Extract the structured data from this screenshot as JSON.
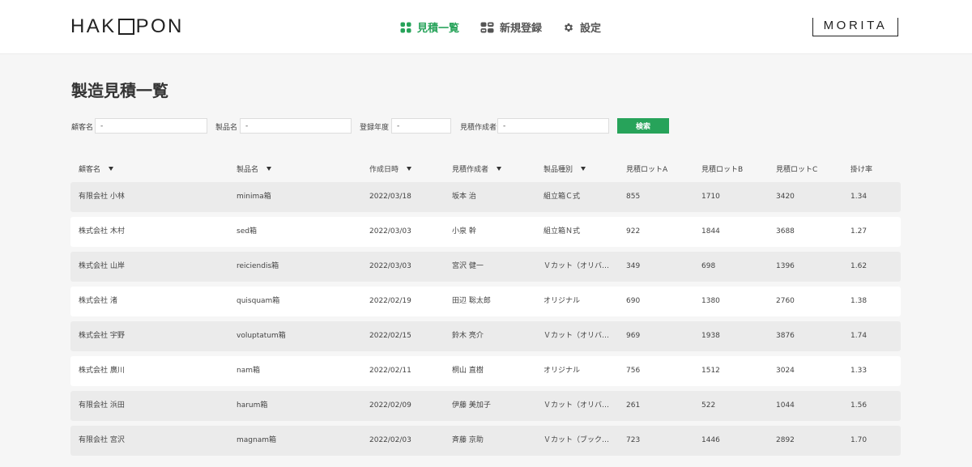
{
  "header": {
    "logo_left": "HAK",
    "logo_right": "PON",
    "brand": "MORITA",
    "nav": [
      {
        "label": "見積一覧",
        "icon": "grid-icon",
        "active": true
      },
      {
        "label": "新規登録",
        "icon": "register-icon",
        "active": false
      },
      {
        "label": "設定",
        "icon": "gear-icon",
        "active": false
      }
    ]
  },
  "page": {
    "title": "製造見積一覧"
  },
  "filters": {
    "customer": {
      "label": "顧客名",
      "value": "-"
    },
    "product": {
      "label": "製品名",
      "value": "-"
    },
    "year": {
      "label": "登録年度",
      "value": "-"
    },
    "author": {
      "label": "見積作成者",
      "value": "-"
    },
    "search_label": "検索"
  },
  "table": {
    "columns": [
      "顧客名",
      "製品名",
      "作成日時",
      "見積作成者",
      "製品種別",
      "見積ロットA",
      "見積ロットB",
      "見積ロットC",
      "掛け率"
    ],
    "rows": [
      [
        "有限会社 小林",
        "minima箱",
        "2022/03/18",
        "坂本 治",
        "組立箱Ｃ式",
        "855",
        "1710",
        "3420",
        "1.34"
      ],
      [
        "株式会社 木村",
        "sed箱",
        "2022/03/03",
        "小泉 幹",
        "組立箱Ｎ式",
        "922",
        "1844",
        "3688",
        "1.27"
      ],
      [
        "株式会社 山岸",
        "reiciendis箱",
        "2022/03/03",
        "宮沢 健一",
        "Ｖカット（オリバ…",
        "349",
        "698",
        "1396",
        "1.62"
      ],
      [
        "株式会社 渚",
        "quisquam箱",
        "2022/02/19",
        "田辺 聡太郎",
        "オリジナル",
        "690",
        "1380",
        "2760",
        "1.38"
      ],
      [
        "株式会社 宇野",
        "voluptatum箱",
        "2022/02/15",
        "鈴木 亮介",
        "Ｖカット（オリバ…",
        "969",
        "1938",
        "3876",
        "1.74"
      ],
      [
        "株式会社 廣川",
        "nam箱",
        "2022/02/11",
        "桐山 直樹",
        "オリジナル",
        "756",
        "1512",
        "3024",
        "1.33"
      ],
      [
        "有限会社 浜田",
        "harum箱",
        "2022/02/09",
        "伊藤 美加子",
        "Ｖカット（オリバ…",
        "261",
        "522",
        "1044",
        "1.56"
      ],
      [
        "有限会社 宮沢",
        "magnam箱",
        "2022/02/03",
        "斉藤 京助",
        "Ｖカット（ブック…",
        "723",
        "1446",
        "2892",
        "1.70"
      ]
    ]
  },
  "colors": {
    "accent": "#27a35a",
    "row_alt": "#ebebeb",
    "background": "#f6f6f6"
  }
}
